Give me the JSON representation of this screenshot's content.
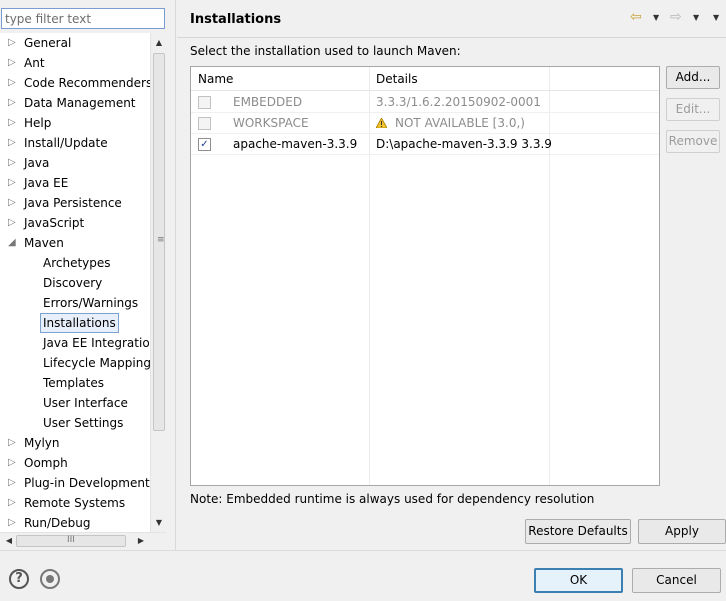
{
  "filter": {
    "placeholder": "type filter text"
  },
  "tree": {
    "items": [
      {
        "label": "General",
        "twisty": "▷"
      },
      {
        "label": "Ant",
        "twisty": "▷"
      },
      {
        "label": "Code Recommenders",
        "twisty": "▷"
      },
      {
        "label": "Data Management",
        "twisty": "▷"
      },
      {
        "label": "Help",
        "twisty": "▷"
      },
      {
        "label": "Install/Update",
        "twisty": "▷"
      },
      {
        "label": "Java",
        "twisty": "▷"
      },
      {
        "label": "Java EE",
        "twisty": "▷"
      },
      {
        "label": "Java Persistence",
        "twisty": "▷"
      },
      {
        "label": "JavaScript",
        "twisty": "▷"
      },
      {
        "label": "Maven",
        "twisty": "◢"
      },
      {
        "label": "Archetypes"
      },
      {
        "label": "Discovery"
      },
      {
        "label": "Errors/Warnings"
      },
      {
        "label": "Installations"
      },
      {
        "label": "Java EE Integration"
      },
      {
        "label": "Lifecycle Mappings"
      },
      {
        "label": "Templates"
      },
      {
        "label": "User Interface"
      },
      {
        "label": "User Settings"
      },
      {
        "label": "Mylyn",
        "twisty": "▷"
      },
      {
        "label": "Oomph",
        "twisty": "▷"
      },
      {
        "label": "Plug-in Development",
        "twisty": "▷"
      },
      {
        "label": "Remote Systems",
        "twisty": "▷"
      },
      {
        "label": "Run/Debug",
        "twisty": "▷"
      }
    ],
    "selected": "Installations"
  },
  "page": {
    "title": "Installations",
    "prompt": "Select the installation used to launch Maven:",
    "note": "Note: Embedded runtime is always used for dependency resolution"
  },
  "table": {
    "headers": {
      "name": "Name",
      "details": "Details"
    },
    "rows": [
      {
        "checked": false,
        "enabled": false,
        "name": "EMBEDDED",
        "details": "3.3.3/1.6.2.20150902-0001"
      },
      {
        "checked": false,
        "enabled": false,
        "name": "WORKSPACE",
        "details": "NOT AVAILABLE [3.0,)",
        "warning": true
      },
      {
        "checked": true,
        "enabled": true,
        "name": "apache-maven-3.3.9",
        "details": "D:\\apache-maven-3.3.9 3.3.9"
      }
    ],
    "checkmark": "✓"
  },
  "side_buttons": {
    "add": "Add...",
    "edit": "Edit...",
    "remove": "Remove"
  },
  "buttons": {
    "restore": "Restore Defaults",
    "apply": "Apply",
    "ok": "OK",
    "cancel": "Cancel"
  },
  "icons": {
    "back": "⇦",
    "forward": "⇨",
    "menu": "▼",
    "help": "?",
    "scroll_up": "▲",
    "scroll_down": "▼",
    "scroll_left": "◀",
    "scroll_right": "▶",
    "vgrip": "≡",
    "hgrip": "III"
  },
  "colors": {
    "accent": "#3c7fb1",
    "selection_bg": "#e7f0fa",
    "nav_back": "#c7a33a"
  }
}
